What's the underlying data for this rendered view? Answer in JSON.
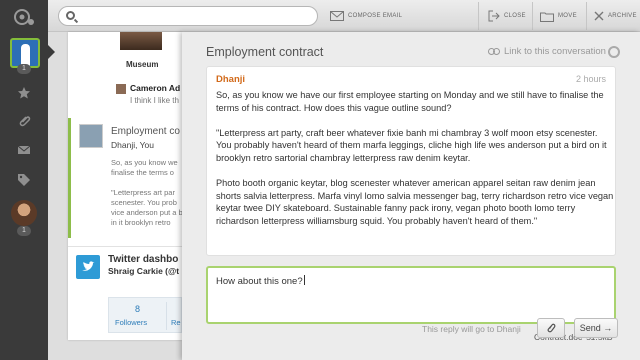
{
  "search": {
    "value": "",
    "placeholder": ""
  },
  "toolbar": {
    "compose_label": "COMPOSE EMAIL",
    "close_label": "CLOSE",
    "move_label": "MOVE",
    "archive_label": "ARCHIVE"
  },
  "rail": {
    "badge_top": "1",
    "badge_bottom": "1",
    "accent_color": "#84bd3a"
  },
  "list": {
    "museum_caption": "Museum",
    "cameron_name": "Cameron Ad",
    "cameron_text": "I think I like th",
    "message": {
      "subject": "Employment co",
      "from": "Dhanji, You",
      "lines_1": [
        "So, as you know we",
        "finalise the terms o"
      ],
      "lines_2": [
        "\"Letterpress art par",
        "scenester. You prob",
        "vice anderson put a bird",
        "in it brooklyn retro"
      ]
    },
    "twitter": {
      "title": "Twitter dashbo",
      "user": "Shraig Carkie (@t",
      "followers_count": "8",
      "followers_label": "Followers",
      "right_label": "Re"
    }
  },
  "conversation": {
    "title": "Employment contract",
    "link_label": "Link to this conversation",
    "message": {
      "from": "Dhanji",
      "time": "2 hours",
      "paragraphs": [
        [
          "So, as you know we have our first employee starting on Monday and we still have to finalise the",
          "terms of his contract. How does this vague outline sound?"
        ],
        [
          "\"Letterpress art party, craft beer whatever fixie banh mi chambray 3 wolf moon etsy scenester.",
          "You probably haven't heard of them marfa leggings, cliche high life wes anderson put a bird on it",
          "brooklyn retro sartorial chambray letterpress raw denim keytar."
        ],
        [
          "Photo booth organic keytar, blog scenester whatever american apparel seitan raw denim jean",
          "shorts salvia letterpress. Marfa vinyl lomo salvia messenger bag, terry richardson retro vice vegan",
          "keytar twee DIY skateboard. Sustainable fanny pack irony, vegan photo booth lomo terry",
          "richardson letterpress williamsburg squid. You probably haven't heard of them.\""
        ]
      ]
    },
    "reply_text": "How about this one?",
    "attachment_name": "Contract.doc",
    "attachment_size": "51.5kB",
    "reply_note": "This reply will go to Dhanji",
    "send_label": "Send →",
    "accent_color": "#a9d36f",
    "sender_color": "#d26a1a"
  }
}
